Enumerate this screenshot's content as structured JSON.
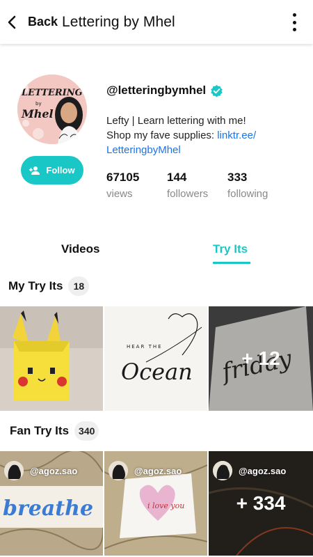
{
  "topbar": {
    "back_label": "Back",
    "title": "Lettering by Mhel"
  },
  "profile": {
    "handle": "@letteringbymhel",
    "bio_line1": "Lefty | Learn lettering with me!",
    "bio_line2_prefix": "Shop my fave supplies: ",
    "bio_link_part1": "linktr.ee/",
    "bio_link_part2": "LetteringbyMhel",
    "follow_label": "Follow",
    "avatar_text_top": "LETTERING",
    "avatar_text_by": "by",
    "avatar_text_name": "Mhel",
    "accent_color": "#1ac7c7",
    "link_color": "#1a73e8"
  },
  "stats": [
    {
      "value": "67105",
      "label": "views"
    },
    {
      "value": "144",
      "label": "followers"
    },
    {
      "value": "333",
      "label": "following"
    }
  ],
  "tabs": [
    {
      "label": "Videos",
      "active": false
    },
    {
      "label": "Try Its",
      "active": true
    }
  ],
  "my_try_its": {
    "title": "My Try Its",
    "count": "18",
    "tiles": [
      {
        "description_icon": "pikachu-origami"
      },
      {
        "art_line1": "HEAR THE",
        "art_line2": "Ocean"
      },
      {
        "art_text": "friday",
        "overlay": "+ 12"
      }
    ]
  },
  "fan_try_its": {
    "title": "Fan Try Its",
    "count": "340",
    "tiles": [
      {
        "user": "@agoz.sao",
        "art_text": "breathe"
      },
      {
        "user": "@agoz.sao",
        "art_text": "i love you"
      },
      {
        "user": "@agoz.sao",
        "overlay": "+ 334"
      }
    ]
  }
}
